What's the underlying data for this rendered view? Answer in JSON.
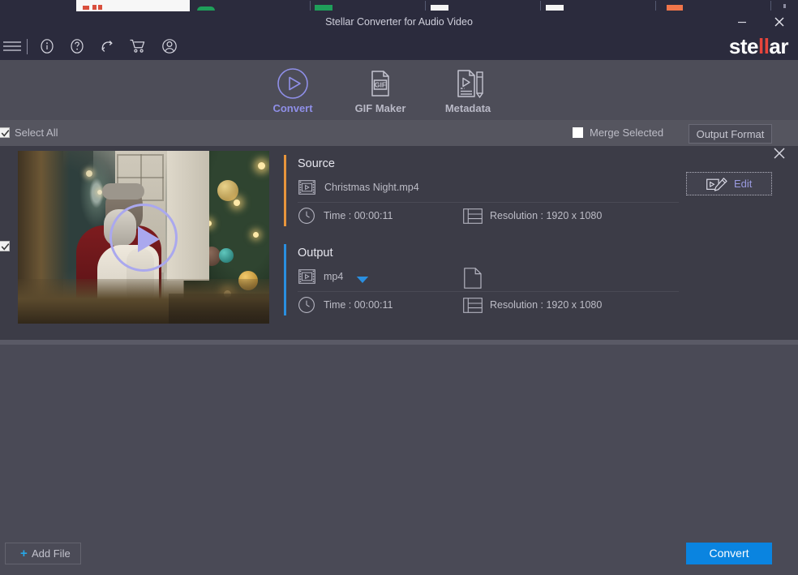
{
  "window": {
    "title": "Stellar Converter for Audio Video",
    "minimize_label": "minimize",
    "close_label": "close",
    "logo_pre": "ste",
    "logo_mid": "ll",
    "logo_post": "ar",
    "accent_red": "#e8453c",
    "titlebar_bg": "#2b2b3d"
  },
  "toolbar": {
    "icons": [
      {
        "name": "hamburger-menu-icon",
        "label": "Menu"
      },
      {
        "name": "info-icon",
        "label": "Info"
      },
      {
        "name": "help-icon",
        "label": "Help"
      },
      {
        "name": "refresh-icon",
        "label": "Check for updates"
      },
      {
        "name": "cart-icon",
        "label": "Buy"
      },
      {
        "name": "account-icon",
        "label": "Account"
      }
    ]
  },
  "tabs": [
    {
      "label": "Convert",
      "icon": "play-circle-icon",
      "active": true
    },
    {
      "label": "GIF Maker",
      "icon": "gif-document-icon",
      "active": false
    },
    {
      "label": "Metadata",
      "icon": "metadata-pencil-icon",
      "active": false
    }
  ],
  "tab_active_color": "#8f8fe8",
  "selection_bar": {
    "select_all_label": "Select All",
    "select_all_checked": true,
    "merge_selected_label": "Merge Selected",
    "merge_selected_checked": false,
    "output_format_label": "Output Format"
  },
  "file_row": {
    "checked": true,
    "thumbnail_alt": "Christmas Night video thumbnail",
    "play_overlay_color": "#aaa8ee",
    "remove_label": "Remove",
    "edit_label": "Edit",
    "source": {
      "heading": "Source",
      "accent_color": "#e8953c",
      "filename": "Christmas Night.mp4",
      "time": "Time : 00:00:11",
      "resolution": "Resolution : 1920 x 1080"
    },
    "output": {
      "heading": "Output",
      "accent_color": "#2a8fe0",
      "format": "mp4",
      "format_options": [
        "mp4"
      ],
      "time": "Time : 00:00:11",
      "resolution": "Resolution : 1920 x 1080",
      "destination": ""
    }
  },
  "footer": {
    "add_file_label": "Add File",
    "add_file_plus": "+",
    "convert_label": "Convert",
    "convert_color": "#0a84e0"
  }
}
